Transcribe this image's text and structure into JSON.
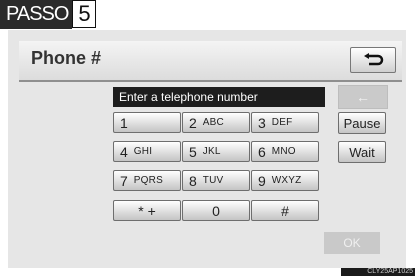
{
  "step": {
    "label": "PASSO",
    "number": "5"
  },
  "header": {
    "title": "Phone #"
  },
  "input": {
    "placeholder_text": "Enter a telephone number"
  },
  "keys": [
    {
      "digit": "1",
      "letters": ""
    },
    {
      "digit": "2",
      "letters": "ABC"
    },
    {
      "digit": "3",
      "letters": "DEF"
    },
    {
      "digit": "4",
      "letters": "GHI"
    },
    {
      "digit": "5",
      "letters": "JKL"
    },
    {
      "digit": "6",
      "letters": "MNO"
    },
    {
      "digit": "7",
      "letters": "PQRS"
    },
    {
      "digit": "8",
      "letters": "TUV"
    },
    {
      "digit": "9",
      "letters": "WXYZ"
    },
    {
      "digit": "* +",
      "letters": ""
    },
    {
      "digit": "0",
      "letters": ""
    },
    {
      "digit": "#",
      "letters": ""
    }
  ],
  "side": {
    "pause_label": "Pause",
    "wait_label": "Wait",
    "ok_label": "OK",
    "backspace_icon": "backspace-arrow-icon"
  },
  "figure_code": "CLY25AP1025"
}
